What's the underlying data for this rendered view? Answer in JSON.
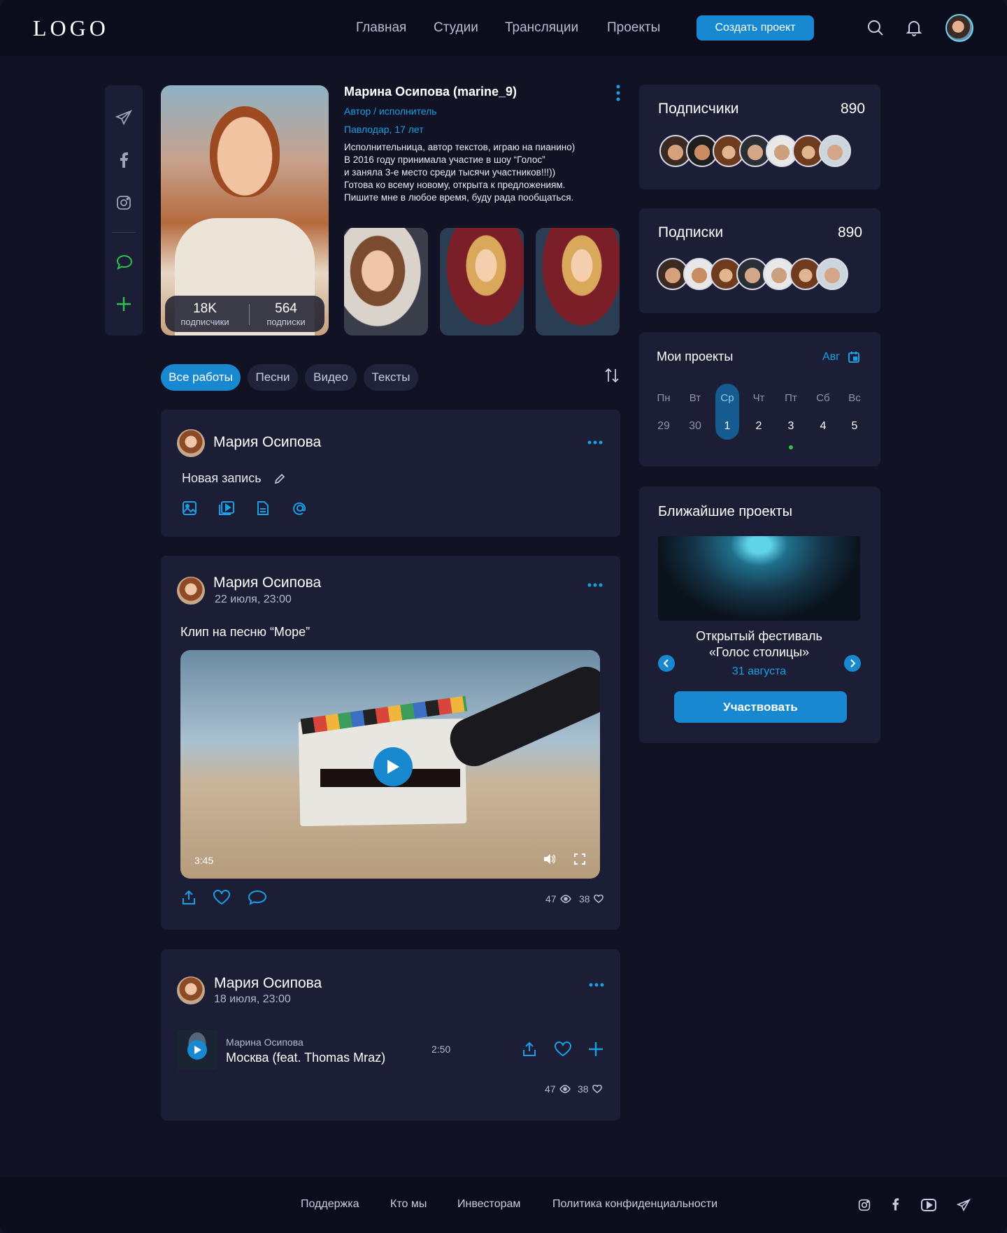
{
  "header": {
    "logo": "LOGO",
    "nav": [
      "Главная",
      "Студии",
      "Трансляции",
      "Проекты"
    ],
    "create_btn": "Создать проект"
  },
  "profile": {
    "name": "Марина Осипова (marine_9)",
    "role": "Автор / исполнитель",
    "location": "Павлодар, 17 лет",
    "bio": [
      "Исполнительница, автор текстов, играю на пианино)",
      "В 2016 году принимала участие в шоу “Голос”",
      "и заняла 3-е место среди тысячи участников!!!))",
      "Готова ко всему новому, открыта к предложениям.",
      "Пишите мне в любое время, буду рада пообщаться."
    ],
    "followers_count": "18K",
    "followers_label": "подписчики",
    "following_count": "564",
    "following_label": "подписки"
  },
  "filters": [
    "Все работы",
    "Песни",
    "Видео",
    "Тексты"
  ],
  "composer": {
    "author": "Мария Осипова",
    "new_post": "Новая запись"
  },
  "post1": {
    "author": "Мария Осипова",
    "date": "22 июля, 23:00",
    "text": "Клип на песню “Море”",
    "duration": "3:45",
    "views": "47",
    "likes": "38"
  },
  "post2": {
    "author": "Мария Осипова",
    "date": "18 июля, 23:00",
    "track_artist": "Марина Осипова",
    "track_title": "Москва (feat. Thomas Mraz)",
    "track_duration": "2:50",
    "views": "47",
    "likes": "38"
  },
  "subscribers": {
    "title": "Подписчики",
    "count": "890"
  },
  "subscriptions": {
    "title": "Подписки",
    "count": "890"
  },
  "projects": {
    "title": "Мои проекты",
    "month": "Авг",
    "days": [
      "Пн",
      "Вт",
      "Ср",
      "Чт",
      "Пт",
      "Сб",
      "Вс"
    ],
    "dates": [
      "29",
      "30",
      "1",
      "2",
      "3",
      "4",
      "5"
    ]
  },
  "upcoming": {
    "title": "Ближайшие проекты",
    "event_line1": "Открытый фестиваль",
    "event_line2": "«Голос столицы»",
    "event_date": "31 августа",
    "button": "Участвовать"
  },
  "footer": {
    "links": [
      "Поддержка",
      "Кто мы",
      "Инвесторам",
      "Политика конфиденциальности"
    ]
  },
  "colors": {
    "accent": "#1889d1",
    "green": "#2ec24a",
    "bg": "#111325",
    "card": "#1b1e35"
  }
}
